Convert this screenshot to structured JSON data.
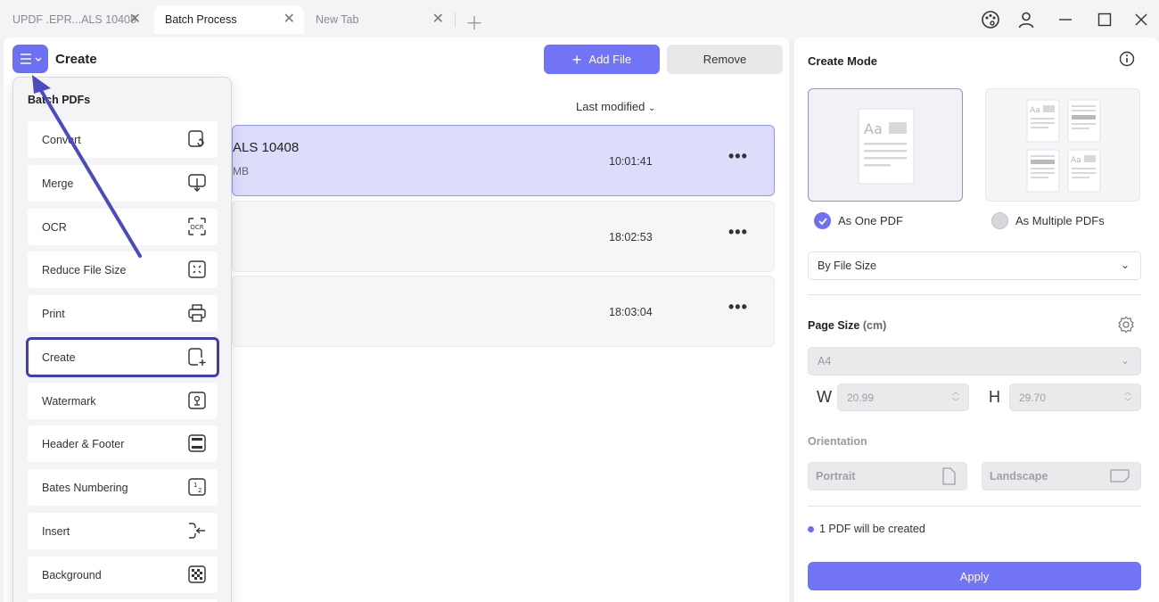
{
  "tabs": [
    {
      "label": "UPDF .EPR...ALS 10408"
    },
    {
      "label": "Batch Process"
    },
    {
      "label": "New Tab"
    }
  ],
  "toolbar": {
    "title": "Create",
    "add_file": "Add File",
    "remove": "Remove",
    "sort_label": "Last modified"
  },
  "files": [
    {
      "name": "ALS 10408",
      "size": "MB",
      "time": "10:01:41"
    },
    {
      "name": "",
      "size": "",
      "time": "18:02:53"
    },
    {
      "name": "",
      "size": "",
      "time": "18:03:04"
    }
  ],
  "menu": {
    "title": "Batch PDFs",
    "items": [
      {
        "label": "Convert",
        "icon": "convert-icon"
      },
      {
        "label": "Merge",
        "icon": "merge-icon"
      },
      {
        "label": "OCR",
        "icon": "ocr-icon"
      },
      {
        "label": "Reduce File Size",
        "icon": "compress-icon"
      },
      {
        "label": "Print",
        "icon": "printer-icon"
      },
      {
        "label": "Create",
        "icon": "create-icon"
      },
      {
        "label": "Watermark",
        "icon": "watermark-icon"
      },
      {
        "label": "Header & Footer",
        "icon": "header-footer-icon"
      },
      {
        "label": "Bates Numbering",
        "icon": "bates-numbering-icon"
      },
      {
        "label": "Insert",
        "icon": "insert-icon"
      },
      {
        "label": "Background",
        "icon": "background-icon"
      }
    ]
  },
  "side": {
    "title": "Create Mode",
    "as_one": "As One PDF",
    "as_multiple": "As Multiple PDFs",
    "sort_by": "By File Size",
    "page_size_label": "Page Size",
    "page_size_unit": "(cm)",
    "page_size_value": "A4",
    "w_label": "W",
    "w_value": "20.99",
    "h_label": "H",
    "h_value": "29.70",
    "orientation_label": "Orientation",
    "portrait": "Portrait",
    "landscape": "Landscape",
    "created_text": "1 PDF will be created",
    "apply": "Apply"
  },
  "colors": {
    "accent": "#7174f5",
    "highlight_box": "#3e3fa8"
  }
}
